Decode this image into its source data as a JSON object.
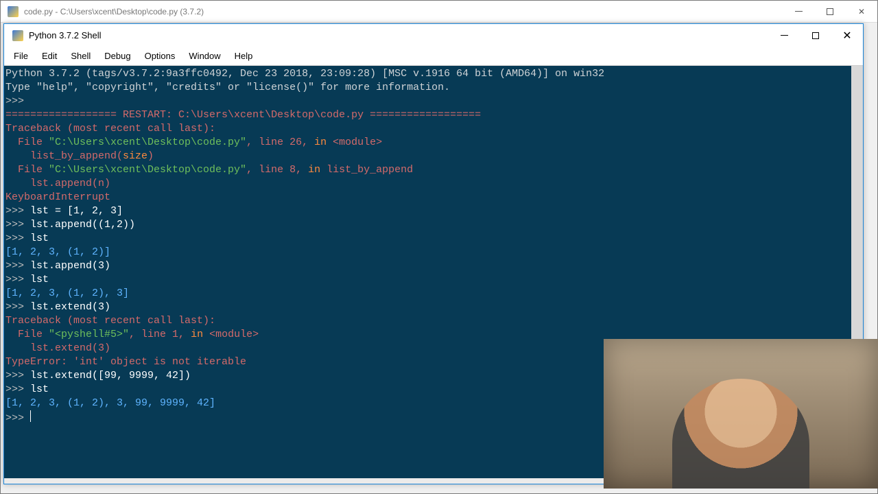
{
  "bg_window": {
    "title": "code.py - C:\\Users\\xcent\\Desktop\\code.py (3.7.2)"
  },
  "fg_window": {
    "title": "Python 3.7.2 Shell"
  },
  "menu": {
    "file": "File",
    "edit": "Edit",
    "shell": "Shell",
    "debug": "Debug",
    "options": "Options",
    "window": "Window",
    "help": "Help"
  },
  "controls": {
    "close_glyph": "✕"
  },
  "terminal": {
    "banner1": "Python 3.7.2 (tags/v3.7.2:9a3ffc0492, Dec 23 2018, 23:09:28) [MSC v.1916 64 bit (AMD64)] on win32",
    "banner2": "Type \"help\", \"copyright\", \"credits\" or \"license()\" for more information.",
    "prompt": ">>> ",
    "restart_pre": "================== RESTART: ",
    "restart_path": "C:\\Users\\xcent\\Desktop\\code.py",
    "restart_post": " ==================",
    "tb_head": "Traceback (most recent call last):",
    "tb_file1a": "  File ",
    "tb_file1b": "\"C:\\Users\\xcent\\Desktop\\code.py\"",
    "tb_file1c": ", line 26, ",
    "tb_in": "in",
    "tb_file1d": " <module>",
    "tb_src1a": "    list_by_append(",
    "tb_src1_kw": "size",
    "tb_src1b": ")",
    "tb_file2a": "  File ",
    "tb_file2b": "\"C:\\Users\\xcent\\Desktop\\code.py\"",
    "tb_file2c": ", line 8, ",
    "tb_file2d": " list_by_append",
    "tb_src2": "    lst.append(n)",
    "kbi": "KeyboardInterrupt",
    "in1": "lst = [1, 2, 3]",
    "in2": "lst.append((1,2))",
    "in3": "lst",
    "out1": "[1, 2, 3, (1, 2)]",
    "in4": "lst.append(3)",
    "in5": "lst",
    "out2": "[1, 2, 3, (1, 2), 3]",
    "in6": "lst.extend(3)",
    "tb2_head": "Traceback (most recent call last):",
    "tb2_file_a": "  File ",
    "tb2_file_b": "\"<pyshell#5>\"",
    "tb2_file_c": ", line 1, ",
    "tb2_file_d": " <module>",
    "tb2_src": "    lst.extend(3)",
    "typeerr": "TypeError: 'int' object is not iterable",
    "in7": "lst.extend([99, 9999, 42])",
    "in8": "lst",
    "out3": "[1, 2, 3, (1, 2), 3, 99, 9999, 42]"
  }
}
